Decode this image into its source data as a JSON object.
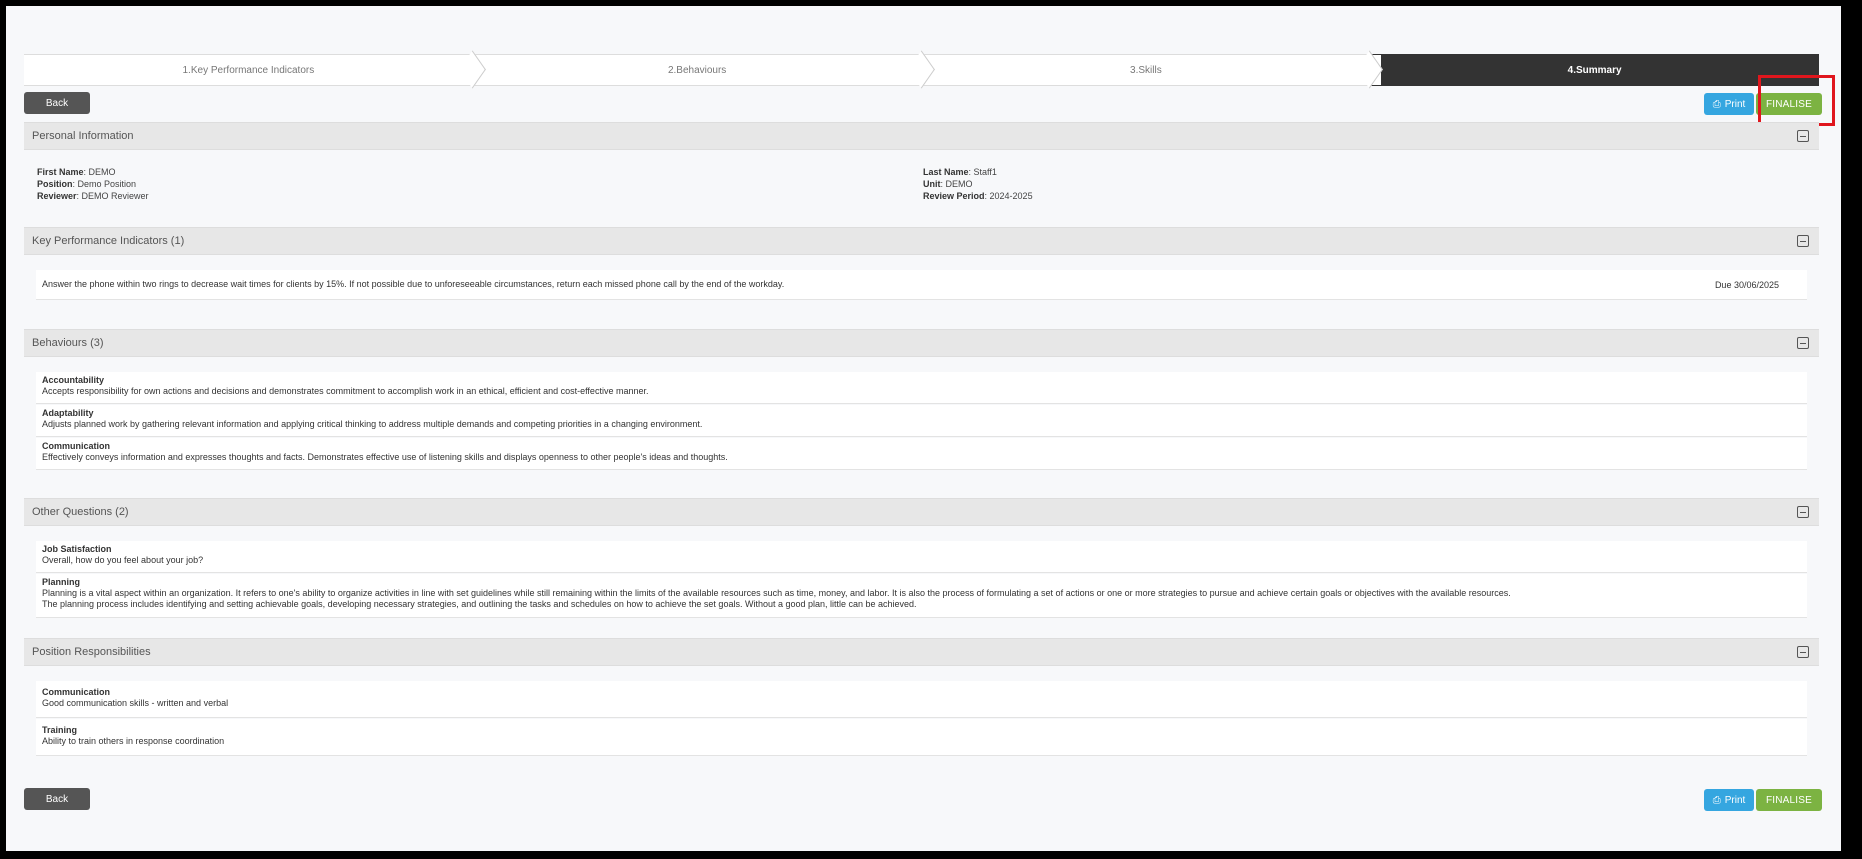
{
  "steps": [
    "1.Key Performance Indicators",
    "2.Behaviours",
    "3.Skills",
    "4.Summary"
  ],
  "buttons": {
    "back": "Back",
    "print": "Print",
    "finalise": "FINALISE"
  },
  "personal": {
    "title": "Personal Information",
    "first_name_label": "First Name",
    "first_name": ": DEMO",
    "position_label": "Position",
    "position": ": Demo Position",
    "reviewer_label": "Reviewer",
    "reviewer": ": DEMO Reviewer",
    "last_name_label": "Last Name",
    "last_name": ": Staff1",
    "unit_label": "Unit",
    "unit": ": DEMO",
    "period_label": "Review Period",
    "period": ": 2024-2025"
  },
  "kpi": {
    "title": "Key Performance Indicators  (1)",
    "items": [
      {
        "text": "Answer the phone within two rings to decrease wait times for clients by 15%. If not possible due to unforeseeable circumstances, return each missed phone call by the end of the workday.",
        "due": "Due 30/06/2025"
      }
    ]
  },
  "behaviours": {
    "title": "Behaviours  (3)",
    "items": [
      {
        "title": "Accountability",
        "text": "Accepts responsibility for own actions and decisions and demonstrates commitment to accomplish work in an ethical, efficient and cost-effective manner."
      },
      {
        "title": "Adaptability",
        "text": "Adjusts planned work by gathering relevant information and applying critical thinking to address multiple demands and competing priorities in a changing environment."
      },
      {
        "title": "Communication",
        "text": "Effectively conveys information and expresses thoughts and facts. Demonstrates effective use of listening skills and displays openness to other people's ideas and thoughts."
      }
    ]
  },
  "other": {
    "title": "Other Questions (2)",
    "items": [
      {
        "title": "Job Satisfaction",
        "text": "Overall, how do you feel about your job?"
      },
      {
        "title": "Planning",
        "text": "Planning is a vital aspect within an organization. It refers to one's ability to organize activities in line with set guidelines while still remaining within the limits of the available resources such as time, money, and labor. It is also the process of formulating a set of actions or one or more strategies to pursue and achieve certain goals or objectives with the available resources.",
        "text2": "The planning process includes identifying and setting achievable goals, developing necessary strategies, and outlining the tasks and schedules on how to achieve the set goals. Without a good plan, little can be achieved."
      }
    ]
  },
  "responsibilities": {
    "title": "Position Responsibilities",
    "items": [
      {
        "title": "Communication",
        "text": "Good communication skills - written and verbal"
      },
      {
        "title": "Training",
        "text": "Ability to train others in response coordination"
      }
    ]
  },
  "colors": {
    "print": "#35a6e0",
    "finalise": "#7cb342",
    "back": "#555555",
    "highlight": "#e0161d"
  }
}
